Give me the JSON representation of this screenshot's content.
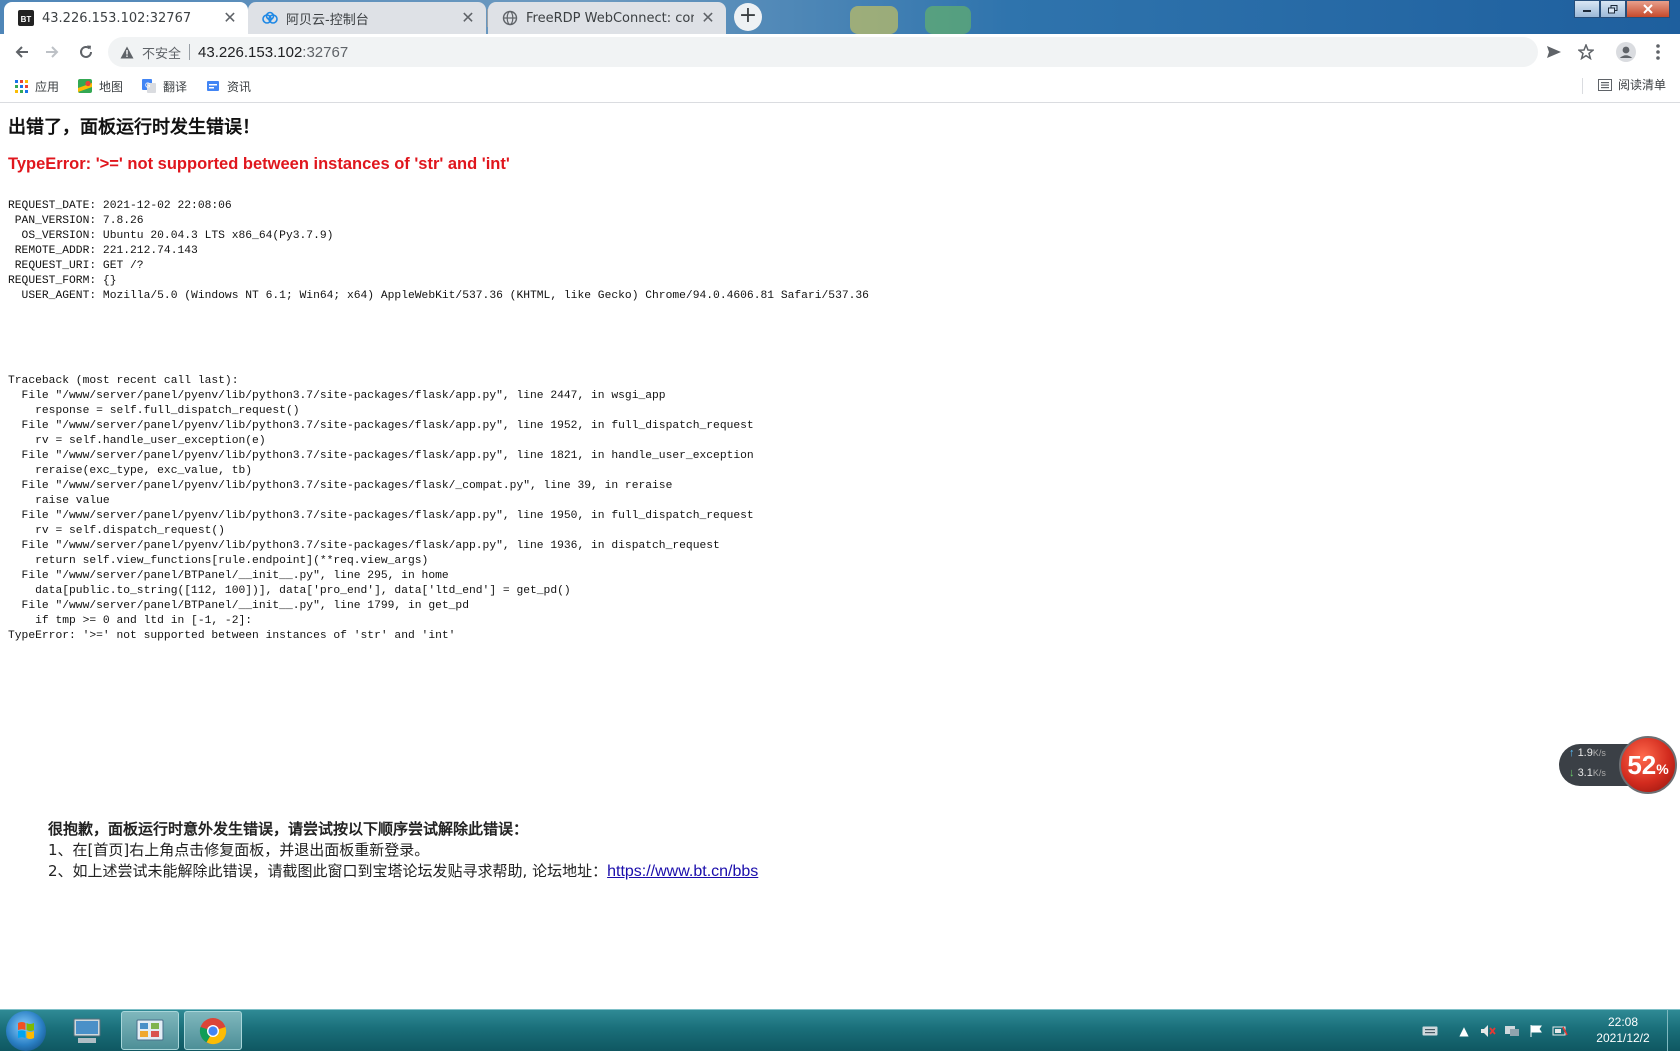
{
  "browser": {
    "tabs": [
      {
        "title": "43.226.153.102:32767",
        "favicon": "BT",
        "active": true
      },
      {
        "title": "阿贝云-控制台",
        "favicon": "cloud-icon",
        "active": false
      },
      {
        "title": "FreeRDP WebConnect: connec",
        "favicon": "globe-icon",
        "active": false
      }
    ],
    "new_tab_label": "+",
    "address": {
      "security_label": "不安全",
      "host": "43.226.153.102",
      "port": ":32767"
    },
    "bookmarks": [
      {
        "label": "应用",
        "icon": "apps-grid-icon"
      },
      {
        "label": "地图",
        "icon": "maps-icon"
      },
      {
        "label": "翻译",
        "icon": "translate-icon"
      },
      {
        "label": "资讯",
        "icon": "news-icon"
      }
    ],
    "reading_list_label": "阅读清单"
  },
  "page": {
    "title": "出错了，面板运行时发生错误！",
    "error_type": "TypeError: '>=' not supported between instances of 'str' and 'int'",
    "env": [
      "REQUEST_DATE: 2021-12-02 22:08:06",
      " PAN_VERSION: 7.8.26",
      "  OS_VERSION: Ubuntu 20.04.3 LTS x86_64(Py3.7.9)",
      " REMOTE_ADDR: 221.212.74.143",
      " REQUEST_URI: GET /?",
      "REQUEST_FORM: {}",
      "  USER_AGENT: Mozilla/5.0 (Windows NT 6.1; Win64; x64) AppleWebKit/537.36 (KHTML, like Gecko) Chrome/94.0.4606.81 Safari/537.36"
    ],
    "traceback": [
      "Traceback (most recent call last):",
      "  File \"/www/server/panel/pyenv/lib/python3.7/site-packages/flask/app.py\", line 2447, in wsgi_app",
      "    response = self.full_dispatch_request()",
      "  File \"/www/server/panel/pyenv/lib/python3.7/site-packages/flask/app.py\", line 1952, in full_dispatch_request",
      "    rv = self.handle_user_exception(e)",
      "  File \"/www/server/panel/pyenv/lib/python3.7/site-packages/flask/app.py\", line 1821, in handle_user_exception",
      "    reraise(exc_type, exc_value, tb)",
      "  File \"/www/server/panel/pyenv/lib/python3.7/site-packages/flask/_compat.py\", line 39, in reraise",
      "    raise value",
      "  File \"/www/server/panel/pyenv/lib/python3.7/site-packages/flask/app.py\", line 1950, in full_dispatch_request",
      "    rv = self.dispatch_request()",
      "  File \"/www/server/panel/pyenv/lib/python3.7/site-packages/flask/app.py\", line 1936, in dispatch_request",
      "    return self.view_functions[rule.endpoint](**req.view_args)",
      "  File \"/www/server/panel/BTPanel/__init__.py\", line 295, in home",
      "    data[public.to_string([112, 100])], data['pro_end'], data['ltd_end'] = get_pd()",
      "  File \"/www/server/panel/BTPanel/__init__.py\", line 1799, in get_pd",
      "    if tmp >= 0 and ltd in [-1, -2]:",
      "TypeError: '>=' not supported between instances of 'str' and 'int'"
    ],
    "help": {
      "heading": "很抱歉，面板运行时意外发生错误，请尝试按以下顺序尝试解除此错误：",
      "step1": "1、在[首页]右上角点击修复面板，并退出面板重新登录。",
      "step2_prefix": "2、如上述尝试未能解除此错误，请截图此窗口到宝塔论坛发贴寻求帮助, 论坛地址：",
      "forum_link": "https://www.bt.cn/bbs"
    }
  },
  "speed_widget": {
    "upload": "1.9",
    "download": "3.1",
    "unit": "K/s",
    "percent": "52",
    "percent_sign": "%"
  },
  "taskbar": {
    "time": "22:08",
    "date": "2021/12/2"
  },
  "colors": {
    "error_red": "#e0161d",
    "link_blue": "#1a0dab",
    "taskbar_teal": "#1a6f7a"
  }
}
